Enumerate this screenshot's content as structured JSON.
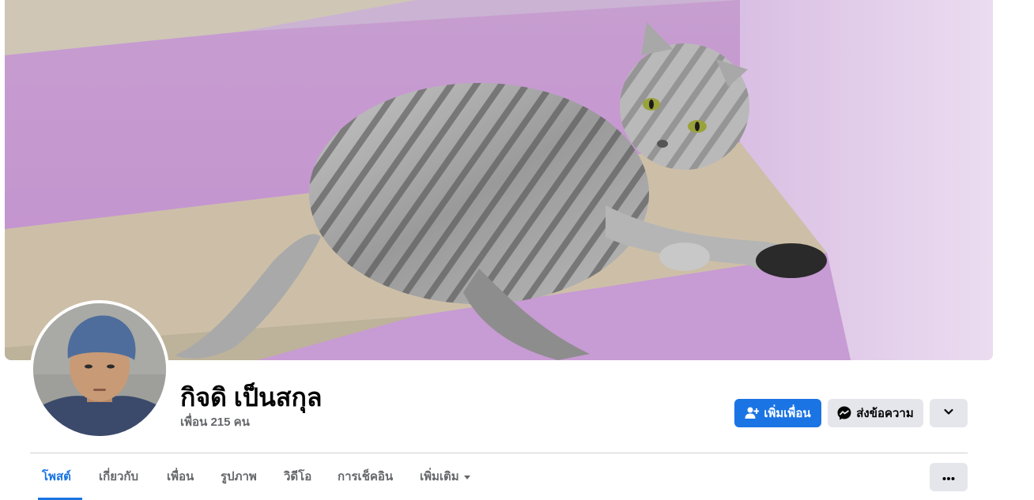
{
  "profile": {
    "name": "กิจดิ เป็นสกุล",
    "friends_count": "เพื่อน 215 คน"
  },
  "actions": {
    "add_friend": "เพิ่มเพื่อน",
    "message": "ส่งข้อความ"
  },
  "tabs": [
    {
      "label": "โพสต์",
      "active": true
    },
    {
      "label": "เกี่ยวกับ"
    },
    {
      "label": "เพื่อน"
    },
    {
      "label": "รูปภาพ"
    },
    {
      "label": "วิดีโอ"
    },
    {
      "label": "การเช็คอิน"
    },
    {
      "label": "เพิ่มเติม"
    }
  ],
  "icons": {
    "add_friend": "person-plus-icon",
    "message": "messenger-icon",
    "more_profile": "chevron-down-icon",
    "tab_more": "caret-down-icon",
    "overflow": "ellipsis-icon"
  },
  "colors": {
    "accent": "#1b74e4",
    "button_grey": "#e4e6eb",
    "secondary_text": "#65676b"
  }
}
